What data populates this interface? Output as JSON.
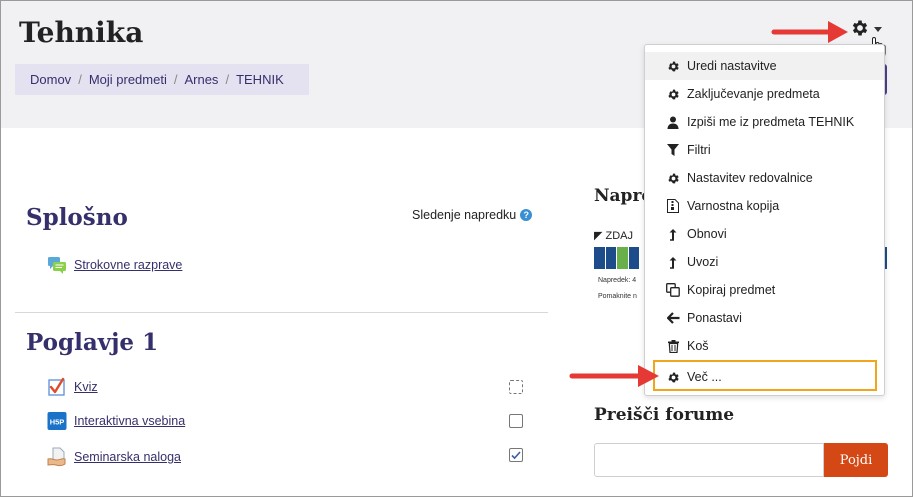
{
  "header": {
    "title": "Tehnika",
    "breadcrumb": [
      "Domov",
      "Moji predmeti",
      "Arnes",
      "TEHNIK"
    ],
    "breadcrumb_separator": "/"
  },
  "main": {
    "sections": [
      {
        "title": "Splošno",
        "progress_label": "Sledenje napredku",
        "activities": [
          {
            "label": "Strokovne razprave",
            "icon": "forum-icon"
          }
        ]
      },
      {
        "title": "Poglavje 1",
        "activities": [
          {
            "label": "Kviz",
            "icon": "quiz-icon",
            "completion": "manual-pending"
          },
          {
            "label": "Interaktivna vsebina",
            "icon": "h5p-icon",
            "completion": "unchecked"
          },
          {
            "label": "Seminarska naloga",
            "icon": "assignment-icon",
            "completion": "checked"
          }
        ]
      }
    ]
  },
  "right_column": {
    "progress_block": {
      "title": "Napre",
      "mode_label": "ZDAJ",
      "progress_text": "Napredek: 4",
      "hint_text": "Pomaknite n"
    },
    "forum_search": {
      "title": "Preišči forume",
      "input_value": "",
      "button_label": "Pojdi"
    }
  },
  "actions_menu": {
    "trigger_icon": "gear-icon",
    "items": [
      {
        "label": "Uredi nastavitve",
        "icon": "gear-icon"
      },
      {
        "label": "Zaključevanje predmeta",
        "icon": "gear-icon"
      },
      {
        "label": "Izpiši me iz predmeta TEHNIK",
        "icon": "user-icon"
      },
      {
        "label": "Filtri",
        "icon": "filter-icon"
      },
      {
        "label": "Nastavitev redovalnice",
        "icon": "gear-icon"
      },
      {
        "label": "Varnostna kopija",
        "icon": "file-archive-icon"
      },
      {
        "label": "Obnovi",
        "icon": "level-up-icon"
      },
      {
        "label": "Uvozi",
        "icon": "level-up-icon"
      },
      {
        "label": "Kopiraj predmet",
        "icon": "copy-icon"
      },
      {
        "label": "Ponastavi",
        "icon": "arrow-left-icon"
      },
      {
        "label": "Koš",
        "icon": "trash-icon"
      },
      {
        "label": "Več ...",
        "icon": "gear-icon"
      }
    ]
  },
  "colors": {
    "brand": "#35306b",
    "accent_button": "#d34814",
    "highlight_box": "#f0a51c",
    "annotation_arrow": "#e53935"
  }
}
